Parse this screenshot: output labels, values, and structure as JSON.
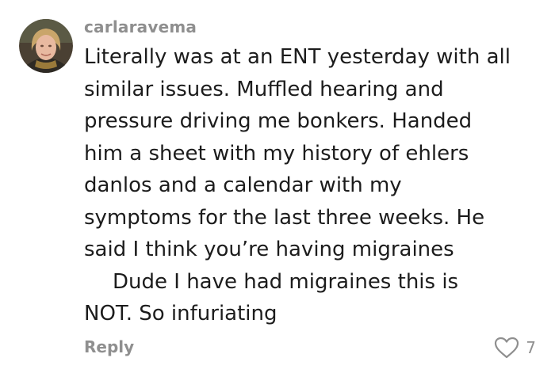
{
  "comment": {
    "username": "carlaravema",
    "text_lines": [
      "Literally was at an ENT yesterday with all",
      "similar issues. Muffled hearing and",
      "pressure driving me bonkers. Handed",
      "him a sheet with my history of ehlers",
      "danlos and a calendar with my",
      "symptoms for the last three weeks. He",
      "said I think you’re having migraines",
      "Dude I have had migraines this is",
      "NOT. So infuriating"
    ],
    "reply_label": "Reply",
    "like_count": "7",
    "avatar_icon": "user-avatar-photo",
    "like_icon": "heart-outline-icon"
  },
  "colors": {
    "background": "#ffffff",
    "username": "#8f8f8f",
    "text": "#1c1c1c",
    "muted": "#8f8f8f"
  }
}
